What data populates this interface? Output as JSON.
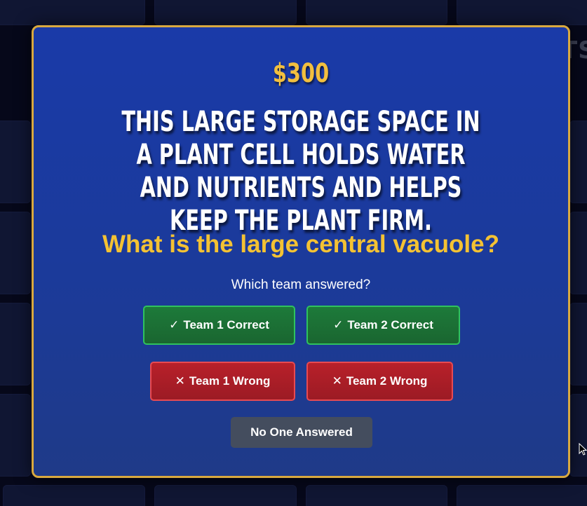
{
  "board": {
    "ghost_text": "TS"
  },
  "modal": {
    "value": "$300",
    "clue": "This large storage space in a plant cell holds water and nutrients and helps keep the plant firm.",
    "answer": "What is the large central vacuole?",
    "prompt": "Which team answered?",
    "buttons": {
      "team1_correct": {
        "icon": "check-icon",
        "glyph": "✓",
        "label": "Team 1 Correct"
      },
      "team2_correct": {
        "icon": "check-icon",
        "glyph": "✓",
        "label": "Team 2 Correct"
      },
      "team1_wrong": {
        "icon": "x-icon",
        "glyph": "✕",
        "label": "Team 1 Wrong"
      },
      "team2_wrong": {
        "icon": "x-icon",
        "glyph": "✕",
        "label": "Team 2 Wrong"
      },
      "no_one": {
        "label": "No One Answered"
      }
    }
  },
  "colors": {
    "modal_bg": "#1a3aa8",
    "modal_border": "#d9a93f",
    "gold": "#f2bf3f",
    "correct_green": "#1d7a3a",
    "wrong_red": "#b8202a",
    "neutral_gray": "#444d5e"
  }
}
